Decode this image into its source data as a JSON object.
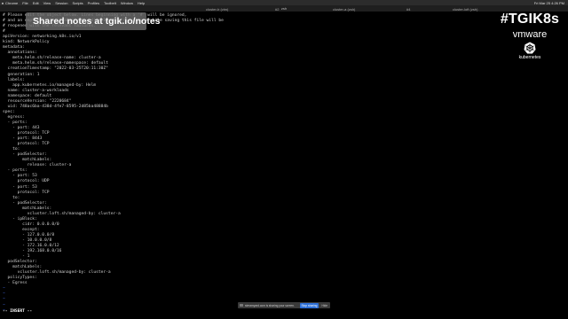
{
  "menubar": {
    "items": [
      "Chrome",
      "File",
      "Edit",
      "View",
      "Session",
      "Scripts",
      "Profiles",
      "Toolbelt",
      "Window",
      "Help"
    ],
    "right_status": "Fri Mar 25  4:26 PM"
  },
  "tabbar": {
    "window_title": "zsh",
    "tabs": [
      "cluster-b (vim)",
      "#2",
      "cluster-a (zsh)",
      "#4",
      "cluster-loft (zsh)"
    ]
  },
  "overlay": {
    "text": "Shared notes at tgik.io/notes"
  },
  "brand": {
    "hashtag": "#TGIK8s",
    "vmware": "vmware",
    "kubernetes": "kubernetes"
  },
  "editor": {
    "lines": [
      "# Please edit the object below. Lines beginning with a '#' will be ignored,",
      "# and an empty file will abort the edit. If an error occurs while saving this file will be",
      "# reopened with the relevant failures.",
      "#",
      "apiVersion: networking.k8s.io/v1",
      "kind: NetworkPolicy",
      "metadata:",
      "  annotations:",
      "    meta.helm.sh/release-name: cluster-a",
      "    meta.helm.sh/release-namespace: default",
      "  creationTimestamp: \"2022-03-25T20:11:30Z\"",
      "  generation: 1",
      "  labels:",
      "    app.kubernetes.io/managed-by: Helm",
      "  name: cluster-a-workloads",
      "  namespace: default",
      "  resourceVersion: \"2220684\"",
      "  uid: 748ac6ba-438d-4fe7-8595-2d85ba48884b",
      "spec:",
      "  egress:",
      "  - ports:",
      "    - port: 443",
      "      protocol: TCP",
      "    - port: 8443",
      "      protocol: TCP",
      "    to:",
      "    - podSelector:",
      "        matchLabels:",
      "          release: cluster-a",
      "  - ports:",
      "    - port: 53",
      "      protocol: UDP",
      "    - port: 53",
      "      protocol: TCP",
      "    to:",
      "    - podSelector:",
      "        matchLabels:",
      "          vcluster.loft.sh/managed-by: cluster-a",
      "    - ipBlock:",
      "        cidr: 0.0.0.0/0",
      "        except:",
      "        - 127.0.0.0/8",
      "        - 10.0.0.0/8",
      "        - 172.16.0.0/12",
      "        - 192.168.0.0/16",
      "        - 1",
      "  podSelector:",
      "    matchLabels:",
      "      vcluster.loft.sh/managed-by: cluster-a",
      "  policyTypes:",
      "  - Egress",
      "~",
      "~",
      "~",
      "~",
      "~"
    ]
  },
  "share_bar": {
    "message": "streamyard.com is sharing your screen.",
    "stop_label": "Stop sharing",
    "hide_label": "Hide"
  },
  "status": {
    "mode": "-- INSERT --"
  },
  "colors": {
    "background": "#000000",
    "text": "#cfcfcf",
    "tilde": "#3a5fcd",
    "accent_button": "#2d6fd6"
  }
}
